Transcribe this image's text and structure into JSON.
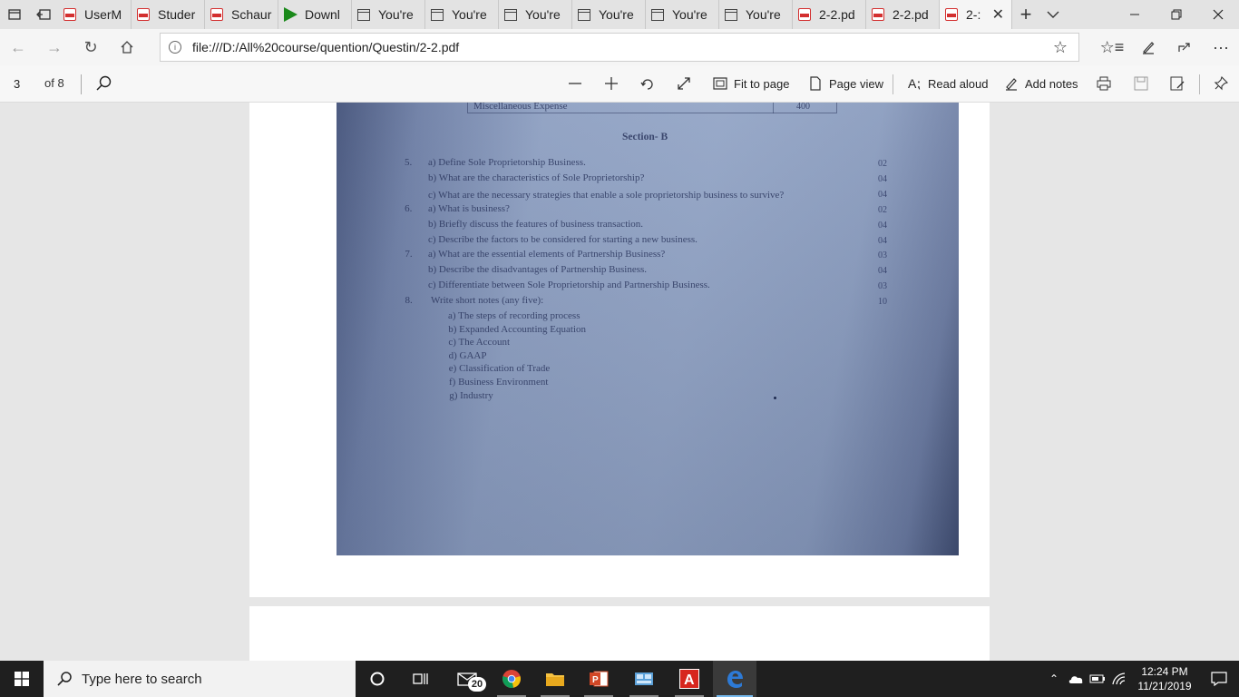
{
  "tabs": [
    {
      "label": "UserM",
      "icon": "pdf-icon"
    },
    {
      "label": "Studer",
      "icon": "pdf-icon"
    },
    {
      "label": "Schaur",
      "icon": "pdf-icon"
    },
    {
      "label": "Downl",
      "icon": "download-play-icon"
    },
    {
      "label": "You're",
      "icon": "page-icon"
    },
    {
      "label": "You're",
      "icon": "page-icon"
    },
    {
      "label": "You're",
      "icon": "page-icon"
    },
    {
      "label": "You're",
      "icon": "page-icon"
    },
    {
      "label": "You're",
      "icon": "page-icon"
    },
    {
      "label": "You're",
      "icon": "page-icon"
    },
    {
      "label": "2-2.pd",
      "icon": "pdf-icon"
    },
    {
      "label": "2-2.pd",
      "icon": "pdf-icon"
    },
    {
      "label": "2-:",
      "icon": "pdf-icon",
      "active": true
    }
  ],
  "address": {
    "url": "file:///D:/All%20course/quention/Questin/2-2.pdf"
  },
  "pdf_toolbar": {
    "page_number": "3",
    "page_total": "of 8",
    "fit_to_page": "Fit to page",
    "page_view": "Page view",
    "read_aloud": "Read aloud",
    "add_notes": "Add notes"
  },
  "document": {
    "top_row_label": "Miscellaneous Expense",
    "top_row_value": "400",
    "section_title": "Section- B",
    "questions": [
      {
        "num": "5.",
        "text": "a) Define Sole Proprietorship Business.",
        "marks": "02"
      },
      {
        "num": "",
        "text": "b) What are the characteristics of Sole Proprietorship?",
        "marks": "04"
      },
      {
        "num": "",
        "text": "c) What are the necessary strategies that enable a sole proprietorship business to survive?",
        "marks": "04"
      },
      {
        "num": "6.",
        "text": "a) What is business?",
        "marks": "02"
      },
      {
        "num": "",
        "text": "b) Briefly discuss the features of business transaction.",
        "marks": "04"
      },
      {
        "num": "",
        "text": "c) Describe the factors to be considered for starting a new business.",
        "marks": "04"
      },
      {
        "num": "7.",
        "text": "a) What are the essential elements of Partnership Business?",
        "marks": "03"
      },
      {
        "num": "",
        "text": "b) Describe the disadvantages of Partnership Business.",
        "marks": "04"
      },
      {
        "num": "",
        "text": "c) Differentiate between Sole Proprietorship and Partnership Business.",
        "marks": "03"
      },
      {
        "num": "8.",
        "text": "Write short notes (any five):",
        "marks": "10"
      }
    ],
    "short_notes": [
      "a)  The steps of recording process",
      "b)  Expanded Accounting Equation",
      "c)  The Account",
      "d)  GAAP",
      "e)  Classification of Trade",
      "f)  Business Environment",
      "g)  Industry"
    ]
  },
  "taskbar": {
    "search_placeholder": "Type here to search",
    "mail_badge": "20",
    "time": "12:24 PM",
    "date": "11/21/2019"
  },
  "colors": {
    "accent": "#76b9ed",
    "pdf_red": "#d32f2f",
    "taskbar": "#1f1f1f",
    "photo_blue": "#8ea0c2"
  }
}
